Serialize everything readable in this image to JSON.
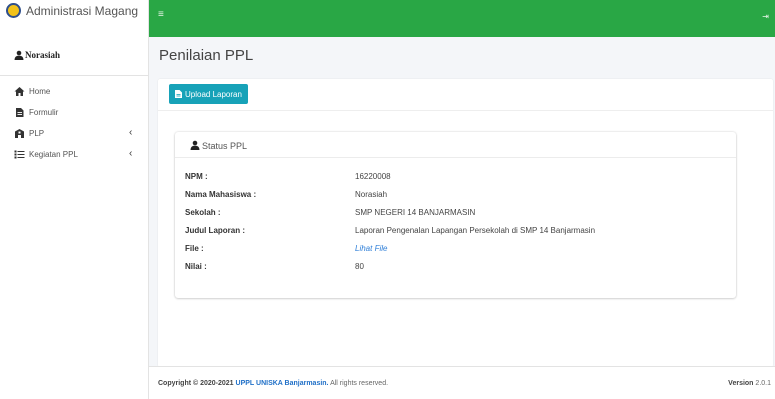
{
  "app": {
    "brand": "Administrasi Magang"
  },
  "user": {
    "name": "Norasiah"
  },
  "sidebar": {
    "items": [
      {
        "label": "Home",
        "icon": "home-icon",
        "has_children": false
      },
      {
        "label": "Formulir",
        "icon": "file-icon",
        "has_children": false
      },
      {
        "label": "PLP",
        "icon": "school-icon",
        "has_children": true,
        "chevron": "‹"
      },
      {
        "label": "Kegiatan PPL",
        "icon": "list-icon",
        "has_children": true,
        "chevron": "‹"
      }
    ]
  },
  "topbar": {
    "menu_icon": "≡",
    "logout_icon": "⇥",
    "color": "#29a745"
  },
  "page": {
    "title": "Penilaian PPL"
  },
  "actions": {
    "upload_label": "Upload Laporan",
    "upload_color": "#17a2b8"
  },
  "status": {
    "title": "Status PPL",
    "rows": [
      {
        "label": "NPM :",
        "value": "16220008"
      },
      {
        "label": "Nama Mahasiswa :",
        "value": "Norasiah"
      },
      {
        "label": "Sekolah :",
        "value": "SMP NEGERI 14 BANJARMASIN"
      },
      {
        "label": "Judul Laporan :",
        "value": "Laporan Pengenalan Lapangan Persekolah di SMP 14 Banjarmasin"
      },
      {
        "label": "File :",
        "value": "Lihat File",
        "link": true
      },
      {
        "label": "Nilai :",
        "value": "80"
      }
    ]
  },
  "footer": {
    "copyright_prefix": "Copyright © 2020-2021",
    "org": "UPPL UNISKA Banjarmasin.",
    "rights": "All rights reserved.",
    "version_label": "Version",
    "version": "2.0.1"
  }
}
